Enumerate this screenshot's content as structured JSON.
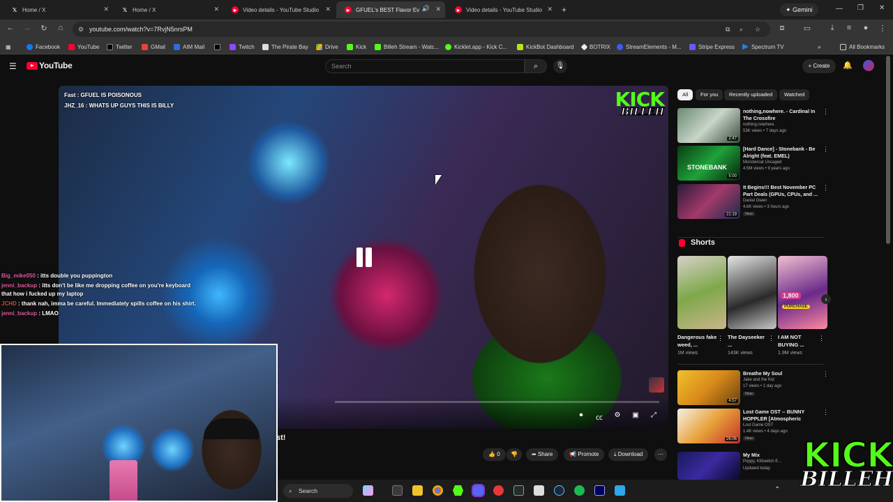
{
  "browser": {
    "tabs": [
      {
        "label": "Home / X",
        "icon": "x-icon"
      },
      {
        "label": "Home / X",
        "icon": "x-icon"
      },
      {
        "label": "Video details - YouTube Studio",
        "icon": "youtube-studio-icon"
      },
      {
        "label": "GFUEL's BEST Flavor Ev",
        "icon": "youtube-icon"
      },
      {
        "label": "Video details - YouTube Studio",
        "icon": "youtube-studio-icon"
      }
    ],
    "gemini_label": "Gemini",
    "url": "youtube.com/watch?v=7RvjN5nrsPM",
    "bookmarks": [
      "Facebook",
      "YouTube",
      "Twitter",
      "GMail",
      "AIM Mail",
      "",
      "Twitch",
      "The Pirate Bay",
      "Drive",
      "Kick",
      "Billeh Stream - Watc...",
      "Kicklet.app - Kick C...",
      "KickBot Dashboard",
      "BOTRIX",
      "StreamElements - M...",
      "Stripe Express",
      "Spectrum TV"
    ],
    "all_bookmarks": "All Bookmarks"
  },
  "youtube": {
    "logo_text": "YouTube",
    "search_placeholder": "Search",
    "create_label": "Create"
  },
  "video": {
    "overlay_captions": [
      "Fast : GFUEL IS POISONOUS",
      "JHZ_16 : WHATS UP GUYS THIS IS BILLY"
    ],
    "kick_text": "KICK",
    "billeh_text": "BILLEH",
    "title_fragment": "st!",
    "like_count": "0",
    "share_label": "Share",
    "promote_label": "Promote",
    "download_label": "Download"
  },
  "chat": [
    {
      "user": "Big_mike050",
      "msg": ": itts double you puppington",
      "color": "#e05aa0"
    },
    {
      "user": "jenni_backup",
      "msg": ": itts don't be like me dropping coffee on you're keyboard that how i fucked up my laptop",
      "color": "#e05aa0"
    },
    {
      "user": "JCHD",
      "msg": ": thank nah, imma be careful. Immediately spills coffee on his shirt.",
      "color": "#e04040"
    },
    {
      "user": "jenni_backup",
      "msg": ": LMAO",
      "color": "#e05aa0"
    }
  ],
  "sidebar": {
    "chips": [
      "All",
      "For you",
      "Recently uploaded",
      "Watched"
    ],
    "recs": [
      {
        "title": "nothing,nowhere. - Cardinal In The Crossfire",
        "channel": "nothing,nowhere.",
        "meta": "53K views • 7 days ago",
        "duration": "2:47",
        "new": ""
      },
      {
        "title": "[Hard Dance] - Stonebank - Be Alright (feat. EMEL) [Monstercat...",
        "channel": "Monstercat Uncaged",
        "meta": "4.5M views • 9 years ago",
        "duration": "5:00",
        "new": ""
      },
      {
        "title": "It Begins!!! Best November PC Part Deals (GPUs, CPUs, and ...",
        "channel": "Daniel Owen",
        "meta": "4.6K views • 3 hours ago",
        "duration": "21:19",
        "new": "New"
      }
    ],
    "shorts_label": "Shorts",
    "shorts": [
      {
        "title": "Dangerous fake weed, ...",
        "views": "1M views"
      },
      {
        "title": "The Dayseeker ...",
        "views": "143K views"
      },
      {
        "title": "I AM NOT BUYING ...",
        "views": "1.9M views"
      }
    ],
    "recs2": [
      {
        "title": "Breathe My Soul",
        "channel": "Jake and the Kid",
        "meta": "17 views • 1 day ago",
        "duration": "4:57",
        "new": "New"
      },
      {
        "title": "Lost Game OST -- BUNNY HOPPLER [Atmospheric Jungl...",
        "channel": "Lost Game OST",
        "meta": "1.4K views • 4 days ago",
        "duration": "26:06",
        "new": "New"
      },
      {
        "title": "My Mix",
        "channel": "Poppy, Killswitch E...",
        "meta": "Updated today",
        "duration": "",
        "new": ""
      }
    ]
  },
  "taskbar": {
    "search_label": "Search"
  },
  "colors": {
    "youtube_red": "#ff0033",
    "kick_green": "#53fc18",
    "background": "#0f0f0f"
  }
}
